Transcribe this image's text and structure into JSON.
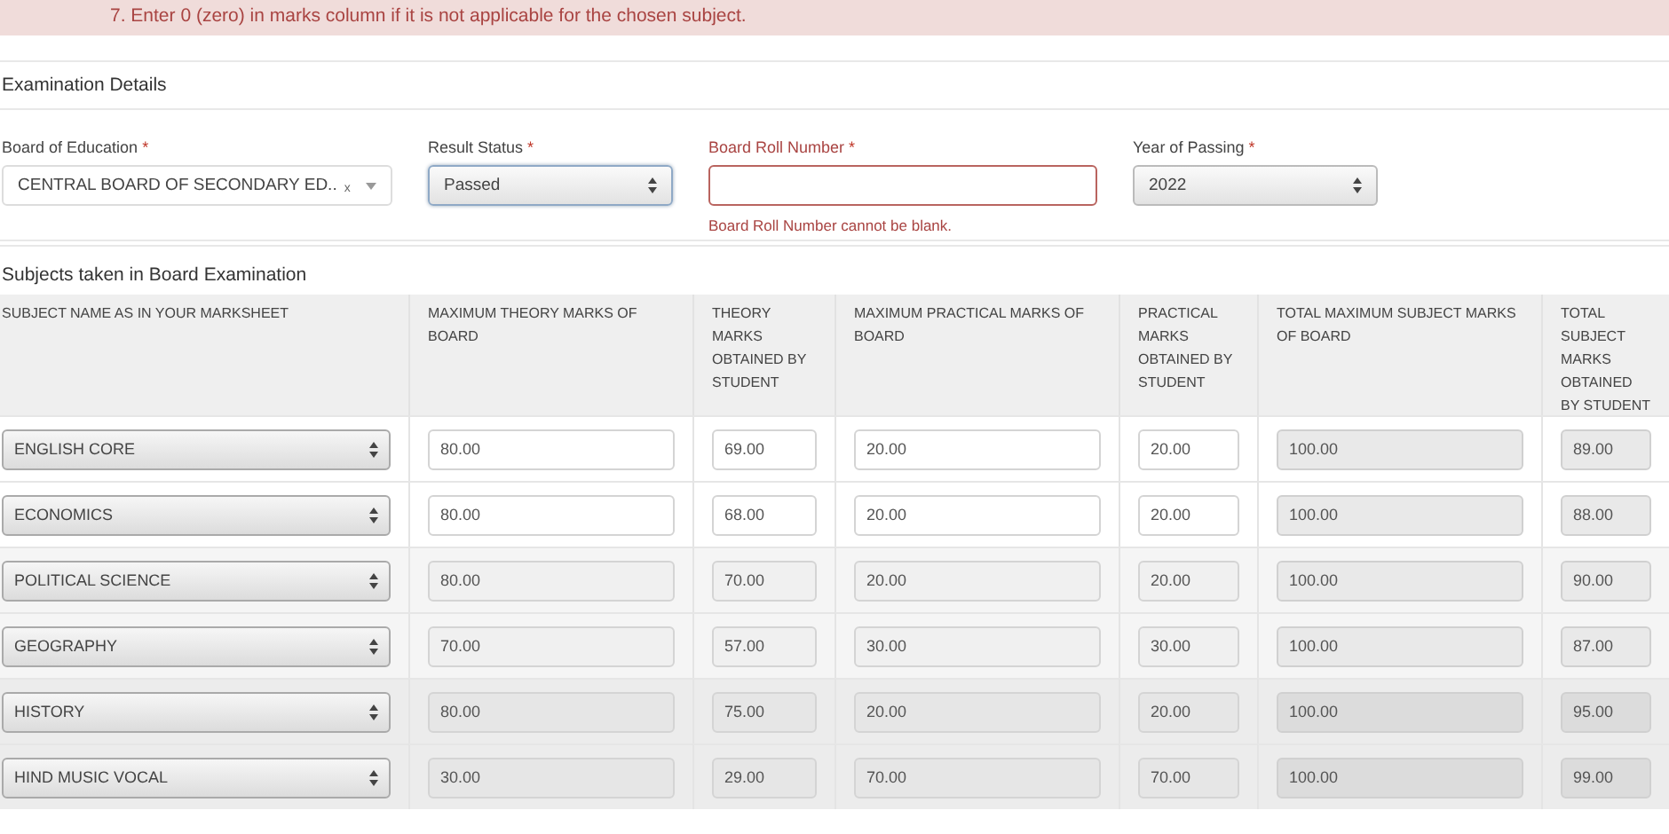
{
  "notice": "7.  Enter 0 (zero) in marks column if it is not applicable for the chosen subject.",
  "examination_details": {
    "title": "Examination Details",
    "fields": [
      {
        "kind": "combo",
        "label": "Board of Education",
        "required_mark": "*",
        "value": "CENTRAL BOARD OF SECONDARY ED..",
        "clear_mark": "x",
        "error": false
      },
      {
        "kind": "select",
        "label": "Result Status",
        "required_mark": "*",
        "value": "Passed",
        "focused": true,
        "error": false
      },
      {
        "kind": "text",
        "label": "Board Roll Number",
        "required_mark": "*",
        "error": true,
        "error_message": "Board Roll Number cannot be blank."
      },
      {
        "kind": "select",
        "label": "Year of Passing",
        "required_mark": "*",
        "value": "2022",
        "error": false
      }
    ]
  },
  "subjects": {
    "title": "Subjects taken in Board Examination",
    "columns": [
      {
        "label": "SUBJECT NAME AS IN YOUR MARKSHEET",
        "kind": "select"
      },
      {
        "label": "MAXIMUM THEORY MARKS OF BOARD",
        "kind": "input"
      },
      {
        "label": "THEORY MARKS OBTAINED BY STUDENT",
        "kind": "input"
      },
      {
        "label": "MAXIMUM PRACTICAL MARKS OF BOARD",
        "kind": "input"
      },
      {
        "label": "PRACTICAL MARKS OBTAINED BY STUDENT",
        "kind": "input"
      },
      {
        "label": "TOTAL MAXIMUM SUBJECT MARKS OF BOARD",
        "kind": "computed"
      },
      {
        "label": "TOTAL SUBJECT MARKS OBTAINED BY STUDENT",
        "kind": "computed"
      }
    ],
    "rows": [
      [
        "ENGLISH CORE",
        "80.00",
        "69.00",
        "20.00",
        "20.00",
        "100.00",
        "89.00"
      ],
      [
        "ECONOMICS",
        "80.00",
        "68.00",
        "20.00",
        "20.00",
        "100.00",
        "88.00"
      ],
      [
        "POLITICAL SCIENCE",
        "80.00",
        "70.00",
        "20.00",
        "20.00",
        "100.00",
        "90.00"
      ],
      [
        "GEOGRAPHY",
        "70.00",
        "57.00",
        "30.00",
        "30.00",
        "100.00",
        "87.00"
      ],
      [
        "HISTORY",
        "80.00",
        "75.00",
        "20.00",
        "20.00",
        "100.00",
        "95.00"
      ],
      [
        "HIND MUSIC VOCAL",
        "30.00",
        "29.00",
        "70.00",
        "70.00",
        "100.00",
        "99.00"
      ]
    ]
  }
}
